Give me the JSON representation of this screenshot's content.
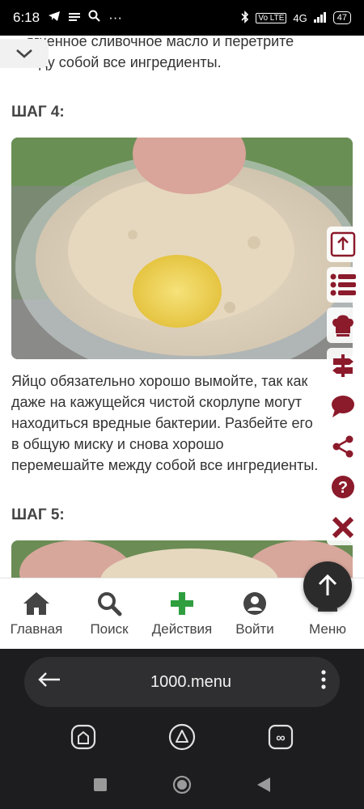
{
  "status_bar": {
    "time": "6:18",
    "network": "4G",
    "volte": "Vo LTE",
    "battery": "47"
  },
  "content": {
    "prev_text": "…ягченное сливочное масло и перетрите между собой все ингредиенты.",
    "step4_title": "ШАГ 4:",
    "step4_text": "Яйцо обязательно хорошо вымойте, так как даже на кажущейся чистой скорлупе могут находиться вредные бактерии. Разбейте его в общую миску и снова хорошо перемешайте между собой все ингредиенты.",
    "step5_title": "ШАГ 5:"
  },
  "bottom_nav": {
    "items": [
      {
        "label": "Главная",
        "icon": "home-icon"
      },
      {
        "label": "Поиск",
        "icon": "search-icon"
      },
      {
        "label": "Действия",
        "icon": "plus-icon"
      },
      {
        "label": "Войти",
        "icon": "user-icon"
      },
      {
        "label": "Меню",
        "icon": "menu-icon"
      }
    ]
  },
  "side_tools": [
    "upload-icon",
    "list-icon",
    "chef-hat-icon",
    "signpost-icon",
    "comment-icon",
    "share-icon",
    "help-icon",
    "close-icon"
  ],
  "browser": {
    "url": "1000.menu"
  },
  "colors": {
    "brand": "#8b1a2b",
    "action_green": "#2e9e3e",
    "nav_text": "#444444"
  }
}
